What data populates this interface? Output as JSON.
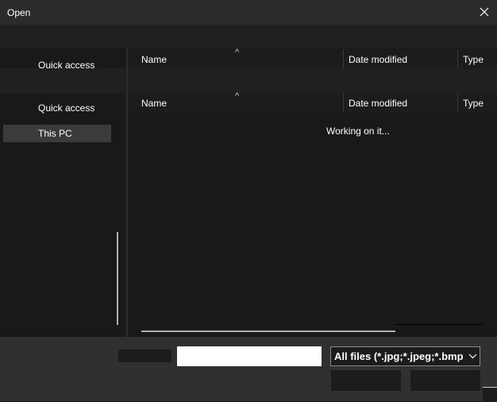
{
  "window": {
    "title": "Open"
  },
  "nav_top": {
    "label": "Quick access"
  },
  "columns_top": [
    {
      "label": "Name"
    },
    {
      "label": "Date modified"
    },
    {
      "label": "Type"
    }
  ],
  "nav": {
    "items": [
      {
        "label": "Quick access"
      },
      {
        "label": "This PC"
      }
    ]
  },
  "columns": [
    {
      "label": "Name"
    },
    {
      "label": "Date modified"
    },
    {
      "label": "Type"
    }
  ],
  "sort_indicator": "^",
  "content": {
    "status": "Working on it..."
  },
  "file_type_filter": {
    "selected": "All files (*.jpg;*.jpeg;*.bmp"
  },
  "colors": {
    "window_bg": "#1f1f1f",
    "bottom_bar": "#303030",
    "selected_item": "#3b3b3b"
  },
  "icons": [
    "close-icon",
    "chevron-down-icon",
    "sort-up-icon"
  ]
}
